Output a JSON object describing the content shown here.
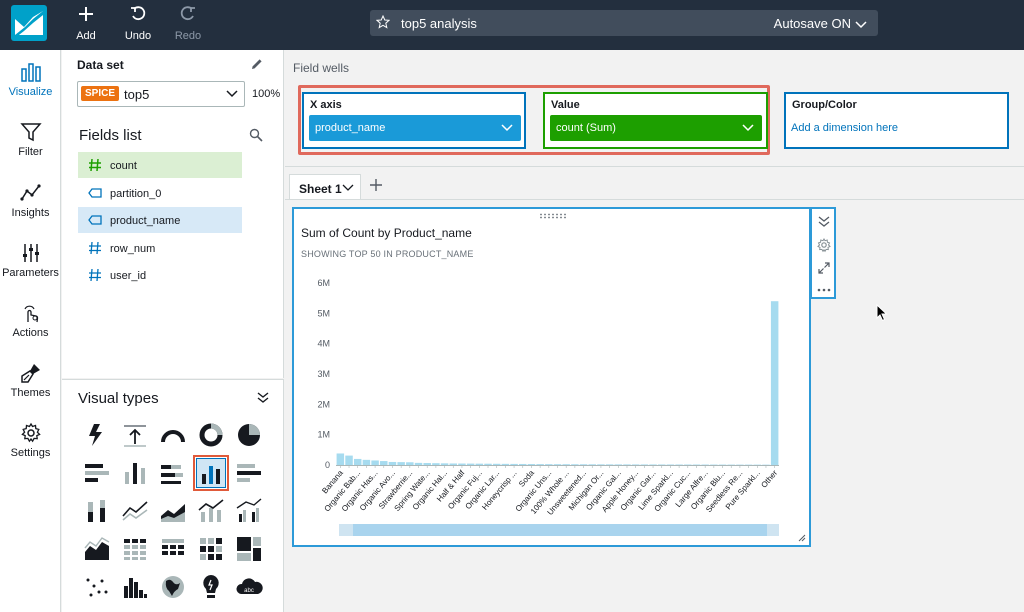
{
  "toolbar": {
    "add_label": "Add",
    "undo_label": "Undo",
    "redo_label": "Redo"
  },
  "analysis": {
    "name": "top5 analysis",
    "autosave": "Autosave ON"
  },
  "nav": {
    "items": [
      {
        "label": "Visualize",
        "icon": "visualize-icon",
        "active": true
      },
      {
        "label": "Filter",
        "icon": "filter-icon"
      },
      {
        "label": "Insights",
        "icon": "insights-icon"
      },
      {
        "label": "Parameters",
        "icon": "parameters-icon"
      },
      {
        "label": "Actions",
        "icon": "actions-icon"
      },
      {
        "label": "Themes",
        "icon": "themes-icon"
      },
      {
        "label": "Settings",
        "icon": "settings-icon"
      }
    ]
  },
  "dataset": {
    "label": "Data set",
    "badge": "SPICE",
    "name": "top5",
    "percent": "100%"
  },
  "fields": {
    "label": "Fields list",
    "items": [
      {
        "name": "count",
        "type": "measure"
      },
      {
        "name": "partition_0",
        "type": "dimension"
      },
      {
        "name": "product_name",
        "type": "dimension"
      },
      {
        "name": "row_num",
        "type": "measure"
      },
      {
        "name": "user_id",
        "type": "measure"
      }
    ]
  },
  "visual_types": {
    "label": "Visual types",
    "selected": "vertical-bar-chart"
  },
  "field_wells": {
    "label": "Field wells",
    "x_axis": {
      "label": "X axis",
      "value": "product_name"
    },
    "value": {
      "label": "Value",
      "value": "count (Sum)"
    },
    "group": {
      "label": "Group/Color",
      "placeholder": "Add a dimension here"
    }
  },
  "sheet": {
    "tab_label": "Sheet 1"
  },
  "visual": {
    "title": "Sum of Count by Product_name",
    "subtitle": "SHOWING TOP 50 IN PRODUCT_NAME"
  },
  "colors": {
    "topbar": "#232f3e",
    "accent": "#0073bb",
    "bar": "#a6dbef",
    "value_pill": "#1d9f00",
    "xaxis_pill": "#1a9ad8",
    "highlight": "#e0695c"
  },
  "chart_data": {
    "type": "bar",
    "title": "Sum of Count by Product_name",
    "subtitle": "SHOWING TOP 50 IN PRODUCT_NAME",
    "ylim": [
      0,
      6000000
    ],
    "yticks": [
      "0",
      "1M",
      "2M",
      "3M",
      "4M",
      "5M",
      "6M"
    ],
    "grid": false,
    "categories": [
      "Banana",
      "Organic Bab...",
      "Organic Has...",
      "Organic Avo...",
      "Strawberrie...",
      "Spring Wate...",
      "Organic Hal...",
      "Half & Half",
      "Organic Fuj...",
      "Organic Lar...",
      "Honeycrisp ...",
      "Soda",
      "Organic Uns...",
      "100% Whole ...",
      "Unsweetened...",
      "Michigan Or...",
      "Organic Gal...",
      "Apple Honey...",
      "Organic Gar...",
      "Lime Sparkl...",
      "Organic Cuc...",
      "Large Alfre...",
      "Organic Blu...",
      "Seedless Re...",
      "Pure Sparkl...",
      "Other"
    ],
    "values": [
      380000,
      310000,
      200000,
      170000,
      150000,
      130000,
      100000,
      95000,
      90000,
      70000,
      65000,
      60000,
      55000,
      50000,
      48000,
      46000,
      44000,
      42000,
      40000,
      38000,
      36000,
      34000,
      32000,
      30000,
      28000,
      27000,
      26000,
      25000,
      24000,
      23000,
      22000,
      21000,
      20000,
      19500,
      19000,
      18500,
      18000,
      17500,
      17000,
      16500,
      16000,
      15500,
      15000,
      14500,
      14000,
      13500,
      13000,
      12500,
      12000,
      11500,
      5400000
    ]
  }
}
